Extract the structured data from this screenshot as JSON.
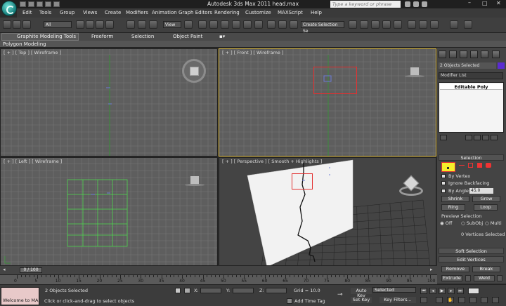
{
  "title": "Autodesk 3ds Max  2011      head.max",
  "search": {
    "placeholder": "Type a keyword or phrase"
  },
  "menu": [
    "Edit",
    "Tools",
    "Group",
    "Views",
    "Create",
    "Modifiers",
    "Animation",
    "Graph Editors",
    "Rendering",
    "Customize",
    "MAXScript",
    "Help"
  ],
  "toolbar": {
    "filter": "All",
    "ref_coord": "View",
    "named_sel": "Create Selection Se"
  },
  "ribbon": {
    "tabs": [
      "Graphite Modeling Tools",
      "Freeform",
      "Selection",
      "Object Paint"
    ],
    "panel": "Polygon Modeling"
  },
  "viewports": {
    "top": "[ + ] [ Top ] [ Wireframe ]",
    "front": "[ + ] [ Front ] [ Wireframe ]",
    "left": "[ + ] [ Left ] [ Wireframe ]",
    "persp": "[ + ] [ Perspective ] [ Smooth + Highlights ]"
  },
  "cmd": {
    "objects": "2 Objects Selected",
    "modifier_list": "Modifier List",
    "stack_item": "Editable Poly",
    "selection_header": "Selection",
    "by_vertex": "By Vertex",
    "ignore_backfacing": "Ignore Backfacing",
    "by_angle": "By Angle:",
    "angle": "45.0",
    "shrink": "Shrink",
    "grow": "Grow",
    "ring": "Ring",
    "loop": "Loop",
    "preview": "Preview Selection",
    "off": "Off",
    "subobj": "SubObj",
    "multi": "Multi",
    "sel_count": "0 Vertices Selected",
    "soft_sel": "Soft Selection",
    "edit_vertices": "Edit Vertices",
    "remove": "Remove",
    "break": "Break",
    "extrude": "Extrude",
    "weld": "Weld"
  },
  "time": {
    "slider": "0 / 100",
    "ticks": [
      "0",
      "5",
      "10",
      "15",
      "20",
      "25",
      "30",
      "35",
      "40",
      "45",
      "50",
      "55",
      "60",
      "65",
      "70",
      "75",
      "80",
      "85",
      "90",
      "95",
      "100"
    ]
  },
  "status": {
    "maxscript": "Welcome to MA",
    "selected": "2 Objects Selected",
    "prompt": "Click or click-and-drag to select objects",
    "x": "X:",
    "y": "Y:",
    "z": "Z:",
    "grid": "Grid = 10.0",
    "add_time_tag": "Add Time Tag",
    "auto_key": "Auto Key",
    "set_key": "Set Key",
    "key_mode": "Selected",
    "key_filters": "Key Filters..."
  }
}
